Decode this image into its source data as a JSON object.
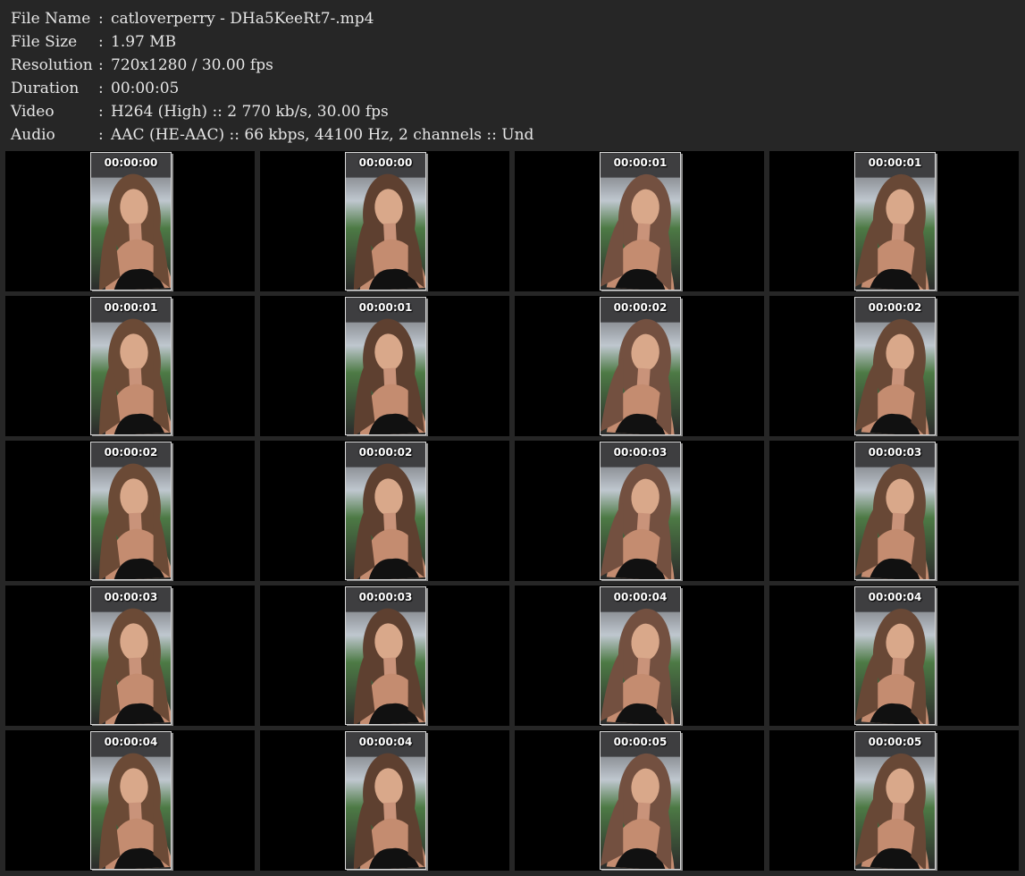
{
  "info": [
    {
      "label": "File Name",
      "value": "catloverperry - DHa5KeeRt7-.mp4"
    },
    {
      "label": "File Size",
      "value": "1.97 MB"
    },
    {
      "label": "Resolution",
      "value": "720x1280 / 30.00 fps"
    },
    {
      "label": "Duration",
      "value": "00:00:05"
    },
    {
      "label": "Video",
      "value": "H264 (High) :: 2 770 kb/s, 30.00 fps"
    },
    {
      "label": "Audio",
      "value": "AAC (HE-AAC) :: 66 kbps, 44100 Hz, 2 channels :: Und"
    }
  ],
  "separator": ":",
  "thumbnails": [
    {
      "timestamp": "00:00:00"
    },
    {
      "timestamp": "00:00:00"
    },
    {
      "timestamp": "00:00:01"
    },
    {
      "timestamp": "00:00:01"
    },
    {
      "timestamp": "00:00:01"
    },
    {
      "timestamp": "00:00:01"
    },
    {
      "timestamp": "00:00:02"
    },
    {
      "timestamp": "00:00:02"
    },
    {
      "timestamp": "00:00:02"
    },
    {
      "timestamp": "00:00:02"
    },
    {
      "timestamp": "00:00:03"
    },
    {
      "timestamp": "00:00:03"
    },
    {
      "timestamp": "00:00:03"
    },
    {
      "timestamp": "00:00:03"
    },
    {
      "timestamp": "00:00:04"
    },
    {
      "timestamp": "00:00:04"
    },
    {
      "timestamp": "00:00:04"
    },
    {
      "timestamp": "00:00:04"
    },
    {
      "timestamp": "00:00:05"
    },
    {
      "timestamp": "00:00:05"
    }
  ],
  "colors": {
    "background": "#262626",
    "text": "#e6e6e6",
    "cell": "#000000",
    "thumb_border": "#d8d8d8"
  }
}
